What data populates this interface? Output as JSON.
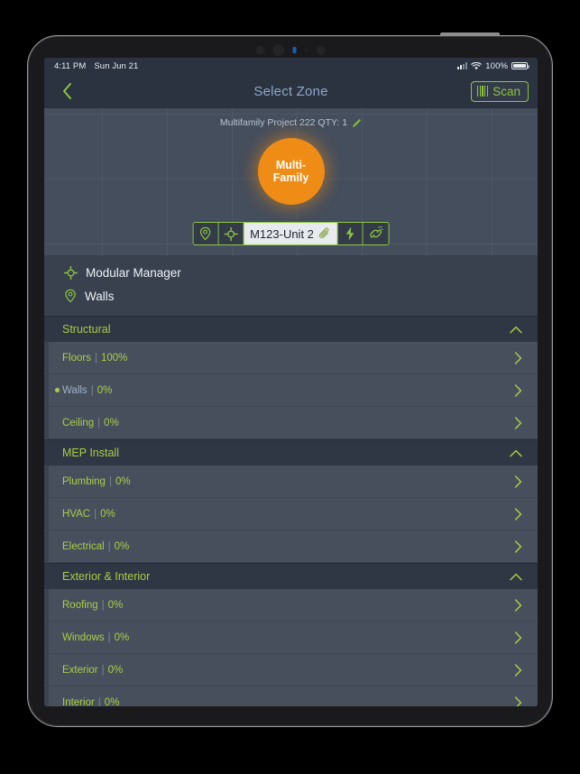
{
  "status_bar": {
    "time": "4:11 PM",
    "date": "Sun Jun 21",
    "battery_percent": "100%",
    "wifi_icon": "wifi-icon",
    "cellular_icon": "cellular-signal-icon",
    "battery_icon": "battery-icon"
  },
  "nav": {
    "back_icon": "chevron-left-icon",
    "title": "Select Zone",
    "scan_label": "Scan",
    "scan_icon": "barcode-icon"
  },
  "hero": {
    "project_label": "Multifamily Project 222 QTY: 1",
    "edit_icon": "pencil-icon",
    "zone_line1": "Multi-",
    "zone_line2": "Family",
    "zone_color": "#ef8c16",
    "unit_bar": {
      "location_icon": "location-pin-icon",
      "target_icon": "crosshair-target-icon",
      "unit_name": "M123-Unit 2",
      "attachment_icon": "paperclip-icon",
      "power_icon": "lightning-bolt-icon",
      "disconnect_icon": "broken-link-icon"
    }
  },
  "breadcrumbs": [
    {
      "icon": "crosshair-target-icon",
      "label": "Modular Manager"
    },
    {
      "icon": "location-pin-icon",
      "label": "Walls"
    }
  ],
  "colors": {
    "accent_green": "#a9ce46",
    "accent_orange": "#ef8c16",
    "selected_text": "#9eb2c6",
    "nav_title": "#8fa8c8"
  },
  "sections": [
    {
      "title": "Structural",
      "collapse_icon": "chevron-up-icon",
      "rows": [
        {
          "name": "Floors",
          "sep": "|",
          "percent": "100%",
          "selected": false,
          "chevron": "chevron-right-icon"
        },
        {
          "name": "Walls",
          "sep": "|",
          "percent": "0%",
          "selected": true,
          "chevron": "chevron-right-icon"
        },
        {
          "name": "Ceiling",
          "sep": "|",
          "percent": "0%",
          "selected": false,
          "chevron": "chevron-right-icon"
        }
      ]
    },
    {
      "title": "MEP Install",
      "collapse_icon": "chevron-up-icon",
      "rows": [
        {
          "name": "Plumbing",
          "sep": "|",
          "percent": "0%",
          "selected": false,
          "chevron": "chevron-right-icon"
        },
        {
          "name": "HVAC",
          "sep": "|",
          "percent": "0%",
          "selected": false,
          "chevron": "chevron-right-icon"
        },
        {
          "name": "Electrical",
          "sep": "|",
          "percent": "0%",
          "selected": false,
          "chevron": "chevron-right-icon"
        }
      ]
    },
    {
      "title": "Exterior & Interior",
      "collapse_icon": "chevron-up-icon",
      "rows": [
        {
          "name": "Roofing",
          "sep": "|",
          "percent": "0%",
          "selected": false,
          "chevron": "chevron-right-icon"
        },
        {
          "name": "Windows",
          "sep": "|",
          "percent": "0%",
          "selected": false,
          "chevron": "chevron-right-icon"
        },
        {
          "name": "Exterior",
          "sep": "|",
          "percent": "0%",
          "selected": false,
          "chevron": "chevron-right-icon"
        },
        {
          "name": "Interior",
          "sep": "|",
          "percent": "0%",
          "selected": false,
          "chevron": "chevron-right-icon"
        }
      ]
    }
  ]
}
